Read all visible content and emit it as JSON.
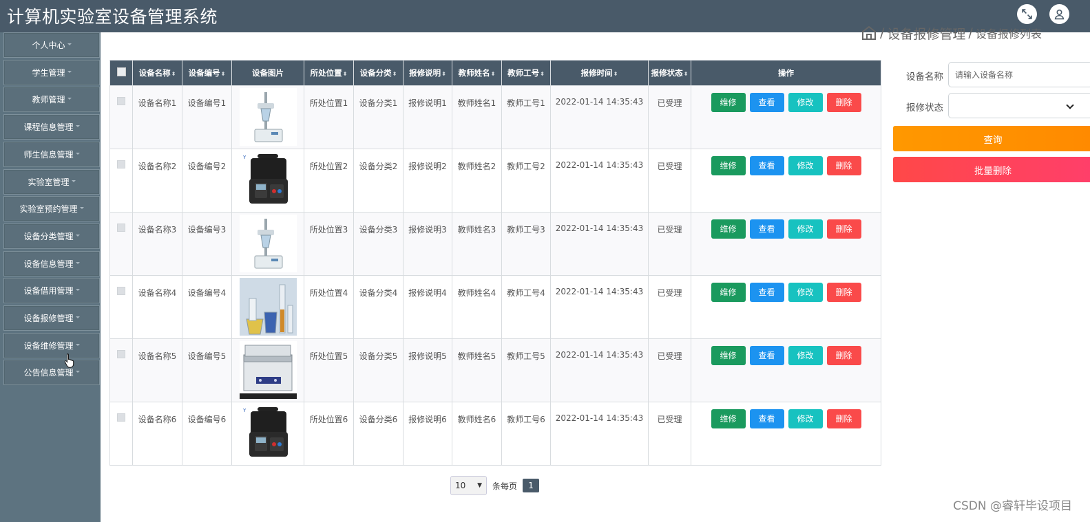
{
  "header": {
    "title": "计算机实验室设备管理系统",
    "fullscreen_icon": "expand-icon",
    "user_icon": "user-icon"
  },
  "sidebar": {
    "items": [
      {
        "label": "个人中心"
      },
      {
        "label": "学生管理"
      },
      {
        "label": "教师管理"
      },
      {
        "label": "课程信息管理"
      },
      {
        "label": "师生信息管理"
      },
      {
        "label": "实验室管理"
      },
      {
        "label": "实验室预约管理"
      },
      {
        "label": "设备分类管理"
      },
      {
        "label": "设备信息管理"
      },
      {
        "label": "设备借用管理"
      },
      {
        "label": "设备报修管理"
      },
      {
        "label": "设备维修管理"
      },
      {
        "label": "公告信息管理"
      }
    ]
  },
  "breadcrumb": {
    "separator": "/",
    "level1": "设备报修管理",
    "level2": "设备报修列表"
  },
  "table": {
    "columns": [
      "设备名称",
      "设备编号",
      "设备图片",
      "所处位置",
      "设备分类",
      "报修说明",
      "教师姓名",
      "教师工号",
      "报修时间",
      "报修状态",
      "操作"
    ],
    "actions": {
      "repair": "维修",
      "view": "查看",
      "edit": "修改",
      "delete": "删除"
    },
    "rows": [
      {
        "name": "设备名称1",
        "code": "设备编号1",
        "image": "lab-apparatus",
        "location": "所处位置1",
        "category": "设备分类1",
        "desc": "报修说明1",
        "teacher": "教师姓名1",
        "teacher_no": "教师工号1",
        "time": "2022-01-14 14:35:43",
        "status": "已受理"
      },
      {
        "name": "设备名称2",
        "code": "设备编号2",
        "image": "instrument-case",
        "location": "所处位置2",
        "category": "设备分类2",
        "desc": "报修说明2",
        "teacher": "教师姓名2",
        "teacher_no": "教师工号2",
        "time": "2022-01-14 14:35:43",
        "status": "已受理"
      },
      {
        "name": "设备名称3",
        "code": "设备编号3",
        "image": "lab-apparatus",
        "location": "所处位置3",
        "category": "设备分类3",
        "desc": "报修说明3",
        "teacher": "教师姓名3",
        "teacher_no": "教师工号3",
        "time": "2022-01-14 14:35:43",
        "status": "已受理"
      },
      {
        "name": "设备名称4",
        "code": "设备编号4",
        "image": "glassware",
        "location": "所处位置4",
        "category": "设备分类4",
        "desc": "报修说明4",
        "teacher": "教师姓名4",
        "teacher_no": "教师工号4",
        "time": "2022-01-14 14:35:43",
        "status": "已受理"
      },
      {
        "name": "设备名称5",
        "code": "设备编号5",
        "image": "ultrasonic-cleaner",
        "location": "所处位置5",
        "category": "设备分类5",
        "desc": "报修说明5",
        "teacher": "教师姓名5",
        "teacher_no": "教师工号5",
        "time": "2022-01-14 14:35:43",
        "status": "已受理"
      },
      {
        "name": "设备名称6",
        "code": "设备编号6",
        "image": "instrument-case",
        "location": "所处位置6",
        "category": "设备分类6",
        "desc": "报修说明6",
        "teacher": "教师姓名6",
        "teacher_no": "教师工号6",
        "time": "2022-01-14 14:35:43",
        "status": "已受理"
      }
    ]
  },
  "pagination": {
    "page_size": "10",
    "per_page_label": "条每页",
    "current_page": "1"
  },
  "search": {
    "name_label": "设备名称",
    "name_placeholder": "请输入设备名称",
    "status_label": "报修状态",
    "status_value": "",
    "query_button": "查询",
    "batch_delete_button": "批量删除"
  },
  "watermark": "CSDN @睿轩毕设项目",
  "colors": {
    "header_bg": "#495a69",
    "sidebar_bg": "#5d7380",
    "repair": "#1a9a5e",
    "view": "#1c93f0",
    "edit": "#17c2c0",
    "delete": "#fa4a4a",
    "query": "#ff9800",
    "batch_delete": "#ff4060"
  }
}
